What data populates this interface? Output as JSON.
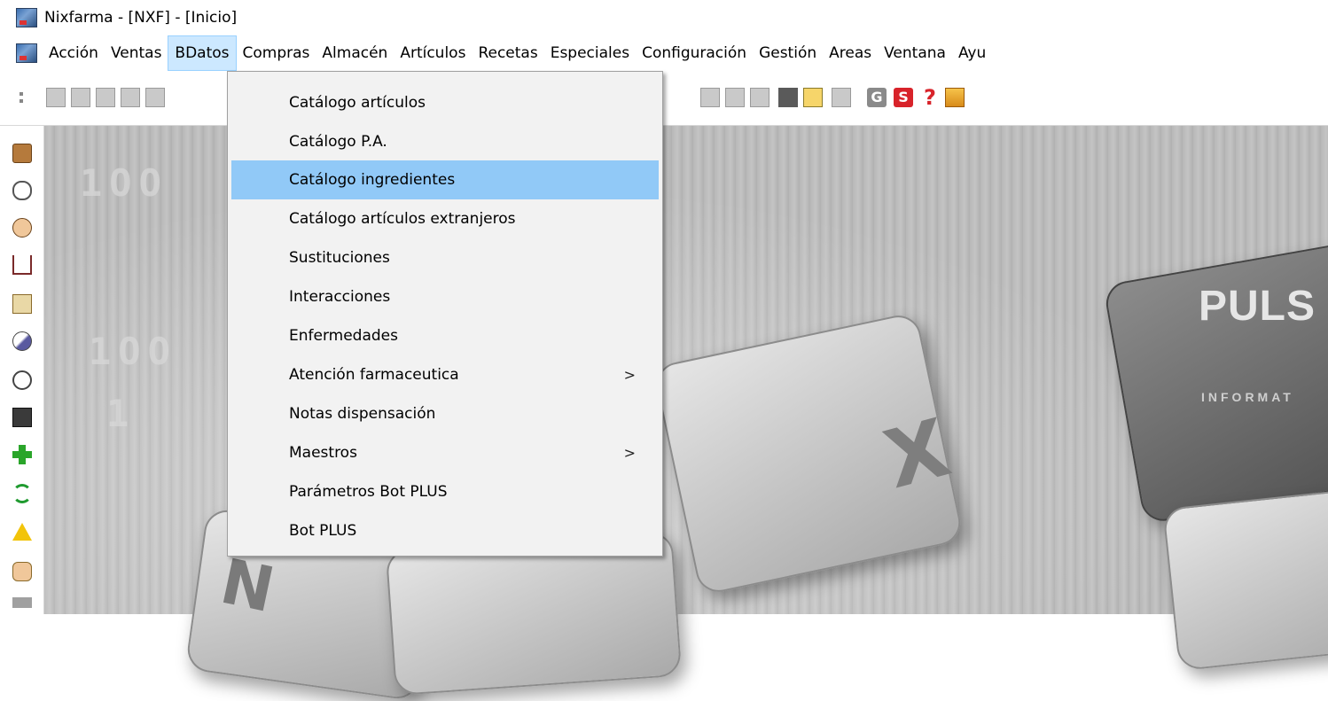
{
  "window": {
    "title": "Nixfarma - [NXF] - [Inicio]"
  },
  "menubar": {
    "items": [
      {
        "label": "Acción"
      },
      {
        "label": "Ventas"
      },
      {
        "label": "BDatos",
        "active": true
      },
      {
        "label": "Compras"
      },
      {
        "label": "Almacén"
      },
      {
        "label": "Artículos"
      },
      {
        "label": "Recetas"
      },
      {
        "label": "Especiales"
      },
      {
        "label": "Configuración"
      },
      {
        "label": "Gestión"
      },
      {
        "label": "Areas"
      },
      {
        "label": "Ventana"
      },
      {
        "label": "Ayu"
      }
    ]
  },
  "toolbar": {
    "g_label": "G",
    "s_label": "S",
    "help_label": "?"
  },
  "dropdown": {
    "items": [
      {
        "label": "Catálogo artículos"
      },
      {
        "label": "Catálogo P.A."
      },
      {
        "label": "Catálogo ingredientes",
        "highlighted": true
      },
      {
        "label": "Catálogo artículos extranjeros"
      },
      {
        "label": "Sustituciones"
      },
      {
        "label": "Interacciones"
      },
      {
        "label": "Enfermedades"
      },
      {
        "label": "Atención farmaceutica",
        "submenu": true
      },
      {
        "label": "Notas dispensación"
      },
      {
        "label": "Maestros",
        "submenu": true
      },
      {
        "label": "Parámetros Bot PLUS"
      },
      {
        "label": "Bot PLUS"
      }
    ],
    "submenu_arrow": ">"
  },
  "background": {
    "logo_text": "PULS",
    "logo_subtext": "INFORMAT",
    "key_x": "X",
    "key_n": "N",
    "binary_1": "1OO",
    "binary_2": "1OO",
    "binary_3": "1"
  },
  "colors": {
    "menu_active_bg": "#cce8ff",
    "dropdown_highlight": "#91c9f7",
    "dropdown_bg": "#f2f2f2"
  }
}
